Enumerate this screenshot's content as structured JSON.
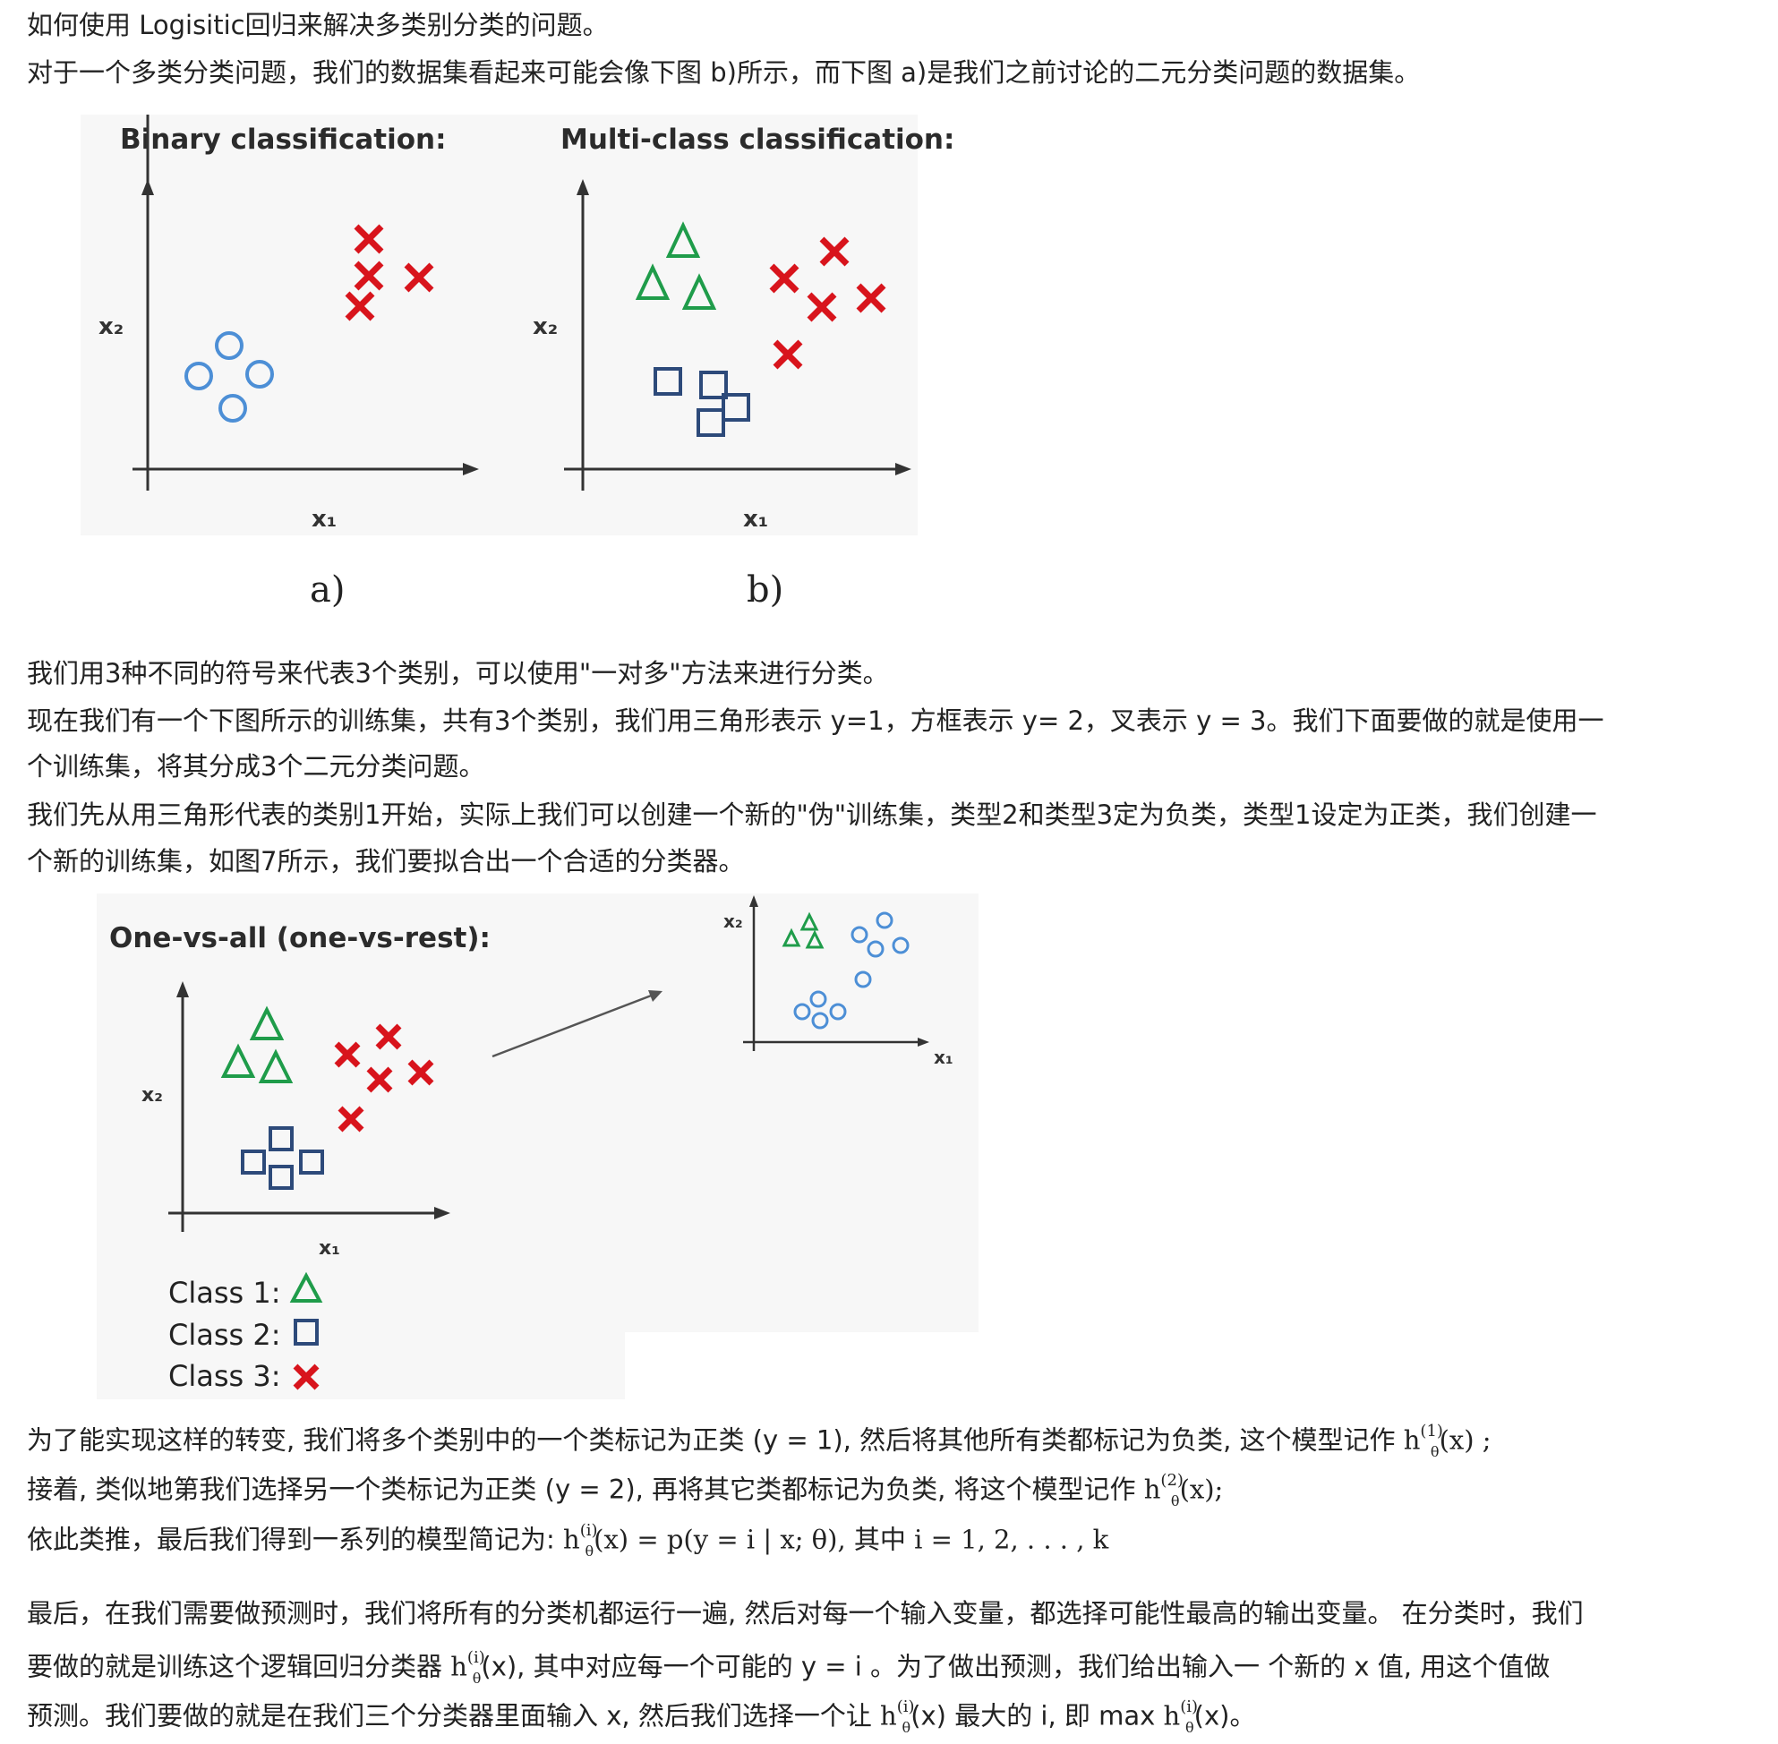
{
  "paragraphs": {
    "p1": "如何使用 Logisitic回归来解决多类别分类的问题。",
    "p2": "对于一个多类分类问题，我们的数据集看起来可能会像下图 b)所示，而下图 a)是我们之前讨论的二元分类问题的数据集。",
    "p3": "我们用3种不同的符号来代表3个类别，可以使用\"一对多\"方法来进行分类。",
    "p4a": "现在我们有一个下图所示的训练集，共有3个类别，我们用三角形表示 y=1，方框表示 y= 2，叉表示 y = 3。我们下面要做的就是使用一",
    "p4b": "个训练集，将其分成3个二元分类问题。",
    "p5a": "我们先从用三角形代表的类别1开始，实际上我们可以创建一个新的\"伪\"训练集，类型2和类型3定为负类，类型1设定为正类，我们创建一",
    "p5b": "个新的训练集，如图7所示，我们要拟合出一个合适的分类器。",
    "p6_pre": "为了能实现这样的转变, 我们将多个类别中的一个类标记为正类 (y = 1), 然后将其他所有类都标记为负类, 这个模型记作 ",
    "p6_sup": "(1)",
    "p6_post": "(x) ;",
    "p7_pre": "接着, 类似地第我们选择另一个类标记为正类 (y = 2), 再将其它类都标记为负类, 将这个模型记作 ",
    "p7_sup": "(2)",
    "p7_post": "(x);",
    "p8_pre": "依此类推，最后我们得到一系列的模型简记为: ",
    "p8_sup": "(i)",
    "p8_post": "(x) = p(y = i | x; θ),   其中 i = 1, 2, . . . , k",
    "p9a": "最后，在我们需要做预测时，我们将所有的分类机都运行一遍, 然后对每一个输入变量，都选择可能性最高的输出变量。 在分类时，我们",
    "p9b_pre": "要做的就是训练这个逻辑回归分类器 ",
    "p9b_sup": "(i)",
    "p9b_post": "(x), 其中对应每一个可能的 y = i 。为了做出预测，我们给出输入一 个新的 x 值, 用这个值做",
    "p9c_pre": "预测。我们要做的就是在我们三个分类器里面输入 x, 然后我们选择一个让 ",
    "p9c_sup1": "(i)",
    "p9c_mid": "(x) 最大的 i, 即 max ",
    "p9c_sup2": "(i)",
    "p9c_post": "(x)。",
    "h": "h",
    "theta": "θ"
  },
  "figure1": {
    "left_title": "Binary classification:",
    "right_title": "Multi-class classification:",
    "x_label": "x₁",
    "y_label": "x₂",
    "caption_a": "a)",
    "caption_b": "b)"
  },
  "figure2": {
    "title": "One-vs-all (one-vs-rest):",
    "x_label": "x₁",
    "y_label": "x₂",
    "legend": [
      {
        "label": "Class 1:",
        "symbol": "triangle",
        "color": "#1f9c4a"
      },
      {
        "label": "Class 2:",
        "symbol": "square",
        "color": "#2d4a7a"
      },
      {
        "label": "Class 3:",
        "symbol": "cross",
        "color": "#d8141c"
      }
    ]
  },
  "colors": {
    "triangle": "#1f9c4a",
    "square": "#2d4a7a",
    "circle": "#4d8fd6",
    "cross": "#d8141c"
  }
}
